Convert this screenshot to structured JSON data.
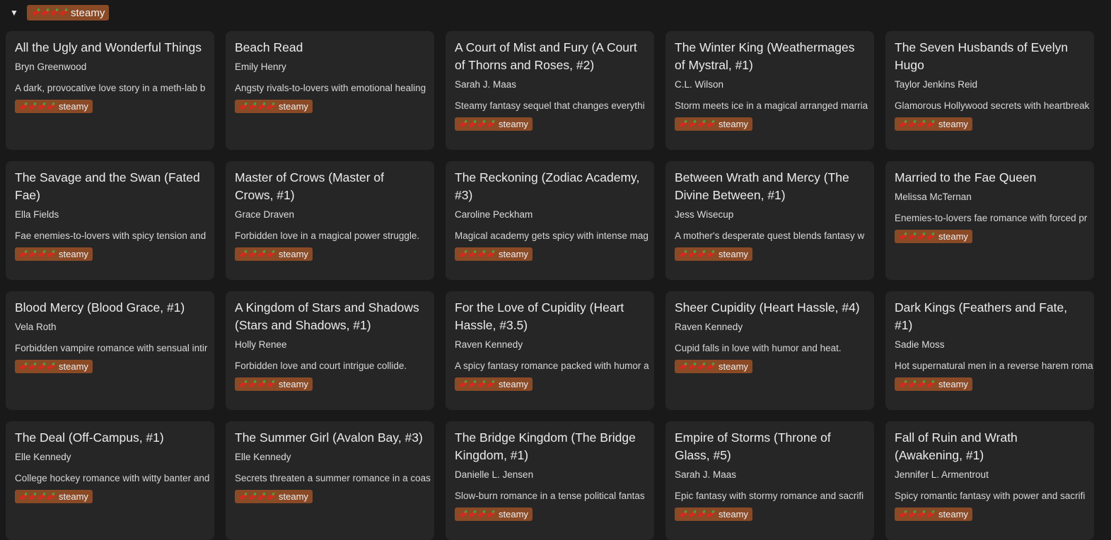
{
  "group": {
    "toggle": "▼",
    "label": "steamy",
    "peppers": 4
  },
  "tag_label": "steamy",
  "colors": {
    "tag_bg": "#8a4a26",
    "card_bg": "#262626",
    "page_bg": "#191919"
  },
  "cards": [
    {
      "title": "All the Ugly and Wonderful Things",
      "author": "Bryn Greenwood",
      "desc": "A dark, provocative love story in a meth-lab b"
    },
    {
      "title": "Beach Read",
      "author": "Emily Henry",
      "desc": "Angsty rivals-to-lovers with emotional healing"
    },
    {
      "title": "A Court of Mist and Fury (A Court of Thorns and Roses, #2)",
      "author": "Sarah J. Maas",
      "desc": "Steamy fantasy sequel that changes everythi"
    },
    {
      "title": "The Winter King (Weathermages of Mystral, #1)",
      "author": "C.L. Wilson",
      "desc": "Storm meets ice in a magical arranged marria"
    },
    {
      "title": "The Seven Husbands of Evelyn Hugo",
      "author": "Taylor Jenkins Reid",
      "desc": "Glamorous Hollywood secrets with heartbreak"
    },
    {
      "title": "The Savage and the Swan (Fated Fae)",
      "author": "Ella Fields",
      "desc": "Fae enemies-to-lovers with spicy tension and"
    },
    {
      "title": "Master of Crows (Master of Crows, #1)",
      "author": "Grace Draven",
      "desc": "Forbidden love in a magical power struggle."
    },
    {
      "title": "The Reckoning (Zodiac Academy, #3)",
      "author": "Caroline Peckham",
      "desc": "Magical academy gets spicy with intense mag"
    },
    {
      "title": "Between Wrath and Mercy (The Divine Between, #1)",
      "author": "Jess Wisecup",
      "desc": "A mother's desperate quest blends fantasy w"
    },
    {
      "title": "Married to the Fae Queen",
      "author": "Melissa McTernan",
      "desc": "Enemies-to-lovers fae romance with forced pr"
    },
    {
      "title": "Blood Mercy (Blood Grace, #1)",
      "author": "Vela Roth",
      "desc": "Forbidden vampire romance with sensual intir"
    },
    {
      "title": "A Kingdom of Stars and Shadows (Stars and Shadows, #1)",
      "author": "Holly Renee",
      "desc": "Forbidden love and court intrigue collide."
    },
    {
      "title": "For the Love of Cupidity (Heart Hassle, #3.5)",
      "author": "Raven Kennedy",
      "desc": "A spicy fantasy romance packed with humor a"
    },
    {
      "title": "Sheer Cupidity (Heart Hassle, #4)",
      "author": "Raven Kennedy",
      "desc": "Cupid falls in love with humor and heat."
    },
    {
      "title": "Dark Kings (Feathers and Fate, #1)",
      "author": "Sadie Moss",
      "desc": "Hot supernatural men in a reverse harem roma"
    },
    {
      "title": "The Deal (Off-Campus, #1)",
      "author": "Elle Kennedy",
      "desc": "College hockey romance with witty banter and"
    },
    {
      "title": "The Summer Girl (Avalon Bay, #3)",
      "author": "Elle Kennedy",
      "desc": "Secrets threaten a summer romance in a coas"
    },
    {
      "title": "The Bridge Kingdom (The Bridge Kingdom, #1)",
      "author": "Danielle L. Jensen",
      "desc": "Slow-burn romance in a tense political fantas"
    },
    {
      "title": "Empire of Storms (Throne of Glass, #5)",
      "author": "Sarah J. Maas",
      "desc": "Epic fantasy with stormy romance and sacrifi"
    },
    {
      "title": "Fall of Ruin and Wrath (Awakening, #1)",
      "author": "Jennifer L. Armentrout",
      "desc": "Spicy romantic fantasy with power and sacrifi"
    }
  ]
}
